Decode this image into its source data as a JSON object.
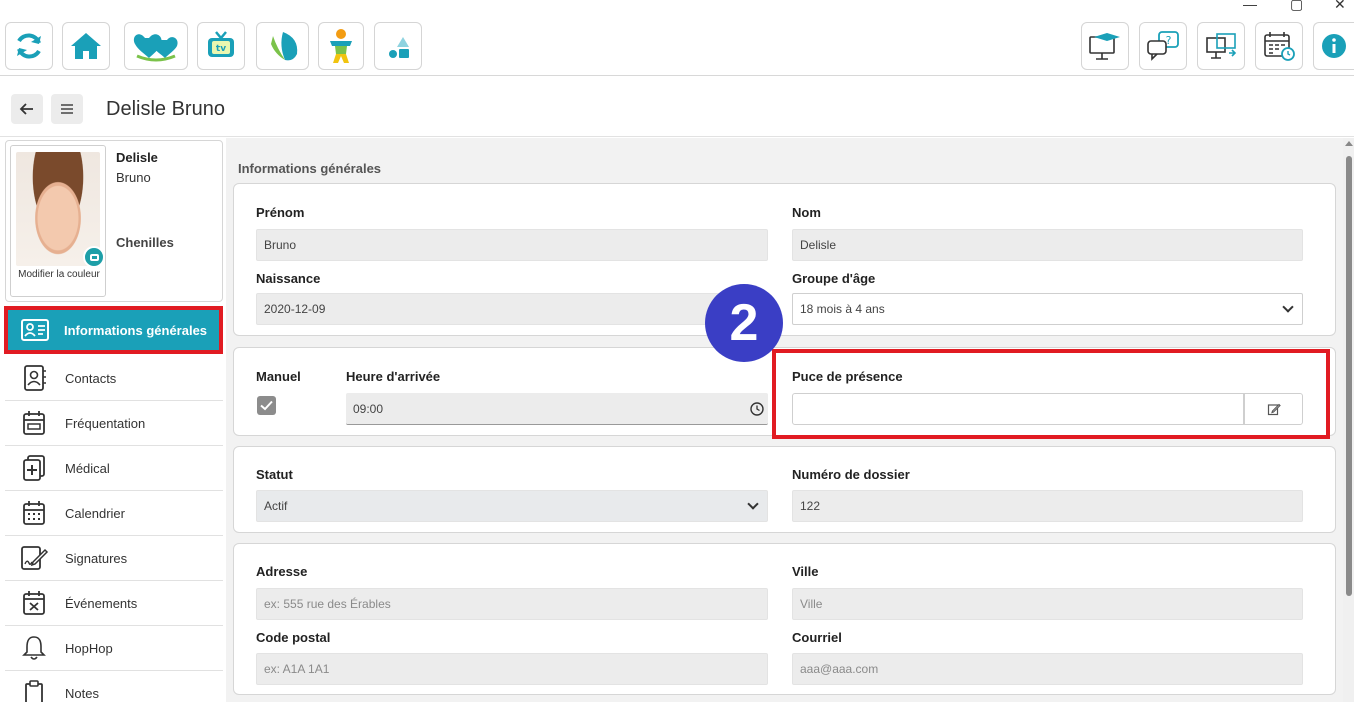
{
  "window": {
    "controls": [
      "—",
      "▢",
      "✕"
    ]
  },
  "toolbar": {
    "left_icons": [
      "refresh-icon",
      "home-icon",
      "hearts-icon",
      "tv-icon",
      "leaf-icon",
      "child-icon",
      "shapes-icon"
    ],
    "right_icons": [
      "monitor-grad-icon",
      "chat-help-icon",
      "screen-sync-icon",
      "calendar-clock-icon",
      "info-icon"
    ],
    "colors": {
      "accent": "#1aa0b8",
      "green": "#7bc24a",
      "orange": "#f39c12"
    }
  },
  "header": {
    "title": "Delisle Bruno"
  },
  "profile": {
    "last_name": "Delisle",
    "first_name": "Bruno",
    "group": "Chenilles",
    "photo_caption": "Modifier la couleur"
  },
  "sidebar": {
    "items": [
      {
        "label": "Informations générales",
        "icon": "id-card-icon",
        "active": true
      },
      {
        "label": "Contacts",
        "icon": "contacts-book-icon"
      },
      {
        "label": "Fréquentation",
        "icon": "attendance-calendar-icon"
      },
      {
        "label": "Médical",
        "icon": "medical-file-icon"
      },
      {
        "label": "Calendrier",
        "icon": "calendar-icon"
      },
      {
        "label": "Signatures",
        "icon": "signature-icon"
      },
      {
        "label": "Événements",
        "icon": "event-calendar-icon"
      },
      {
        "label": "HopHop",
        "icon": "bell-icon"
      },
      {
        "label": "Notes",
        "icon": "clipboard-icon"
      }
    ]
  },
  "main": {
    "section_title": "Informations générales",
    "identity": {
      "prenom_label": "Prénom",
      "prenom_value": "Bruno",
      "nom_label": "Nom",
      "nom_value": "Delisle",
      "naissance_label": "Naissance",
      "naissance_value": "2020-12-09",
      "groupe_label": "Groupe d'âge",
      "groupe_value": "18 mois à 4 ans"
    },
    "presence": {
      "manuel_label": "Manuel",
      "manuel_checked": true,
      "arrivee_label": "Heure d'arrivée",
      "arrivee_value": "09:00",
      "puce_label": "Puce de présence",
      "puce_value": ""
    },
    "status": {
      "statut_label": "Statut",
      "statut_value": "Actif",
      "dossier_label": "Numéro de dossier",
      "dossier_value": "122"
    },
    "address": {
      "adresse_label": "Adresse",
      "adresse_placeholder": "ex: 555 rue des Érables",
      "ville_label": "Ville",
      "ville_placeholder": "Ville",
      "postal_label": "Code postal",
      "postal_placeholder": "ex: A1A 1A1",
      "courriel_label": "Courriel",
      "courriel_value": "aaa@aaa.com"
    }
  },
  "annotation": {
    "step": "2",
    "highlight_color": "#e11b22",
    "badge_color": "#3a3ec5"
  }
}
